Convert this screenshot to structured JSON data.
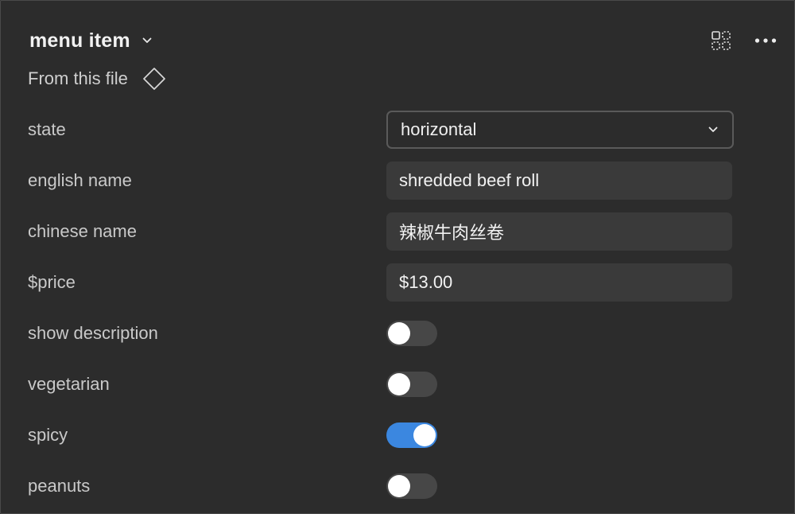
{
  "header": {
    "title": "menu item",
    "source_label": "From this file"
  },
  "icons": {
    "title_dropdown": "chevron-down-icon",
    "component": "diamond-icon",
    "grid": "dashed-grid-icon",
    "more": "more-horizontal-icon"
  },
  "properties": {
    "state": {
      "label": "state",
      "value": "horizontal"
    },
    "english_name": {
      "label": "english name",
      "value": "shredded beef roll"
    },
    "chinese_name": {
      "label": "chinese name",
      "value": "辣椒牛肉丝卷"
    },
    "price": {
      "label": "$price",
      "value": "$13.00"
    },
    "show_description": {
      "label": "show description",
      "on": false
    },
    "vegetarian": {
      "label": "vegetarian",
      "on": false
    },
    "spicy": {
      "label": "spicy",
      "on": true
    },
    "peanuts": {
      "label": "peanuts",
      "on": false
    }
  },
  "colors": {
    "background": "#2c2c2c",
    "input_bg": "#3a3a3a",
    "toggle_off": "#474747",
    "toggle_on": "#3b87e0"
  }
}
